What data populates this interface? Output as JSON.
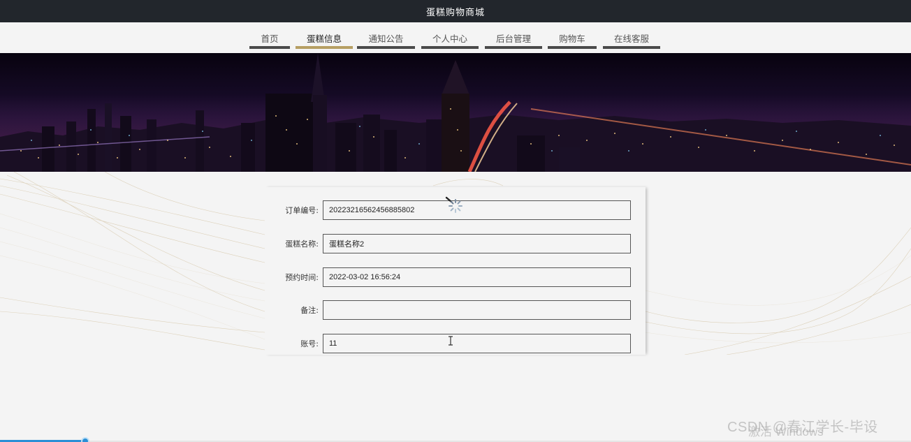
{
  "header": {
    "title": "蛋糕购物商城"
  },
  "nav": {
    "items": [
      {
        "label": "首页"
      },
      {
        "label": "蛋糕信息",
        "active": true
      },
      {
        "label": "通知公告"
      },
      {
        "label": "个人中心"
      },
      {
        "label": "后台管理"
      },
      {
        "label": "购物车"
      },
      {
        "label": "在线客服"
      }
    ]
  },
  "form": {
    "order_no": {
      "label": "订单编号:",
      "value": "20223216562456885802"
    },
    "cake_name": {
      "label": "蛋糕名称:",
      "value": "蛋糕名称2"
    },
    "reserve_time": {
      "label": "预约时间:",
      "value": "2022-03-02 16:56:24"
    },
    "remark": {
      "label": "备注:",
      "value": ""
    },
    "account": {
      "label": "账号:",
      "value": "11"
    }
  },
  "watermarks": {
    "windows": "激活 Windows",
    "csdn": "CSDN @春江学长-毕设"
  },
  "colors": {
    "topbar": "#22262c",
    "nav_active_underline": "#b69f63",
    "nav_underline": "#4a4a4a",
    "progress": "#2a8fd6"
  },
  "loading": {
    "progress_fraction": 0.09
  }
}
